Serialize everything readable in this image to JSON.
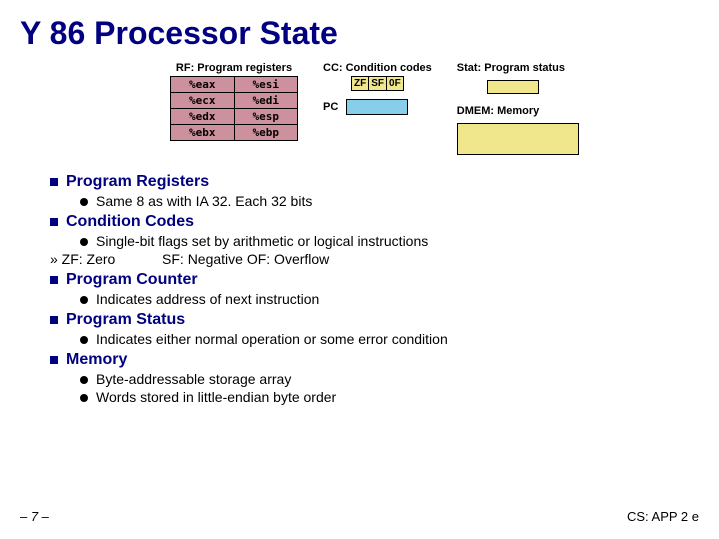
{
  "title": "Y 86 Processor State",
  "diagram": {
    "rf_label": "RF: Program registers",
    "regs": [
      [
        "%eax",
        "%esi"
      ],
      [
        "%ecx",
        "%edi"
      ],
      [
        "%edx",
        "%esp"
      ],
      [
        "%ebx",
        "%ebp"
      ]
    ],
    "cc_label": "CC: Condition codes",
    "cc_cells": [
      "ZF",
      "SF",
      "0F"
    ],
    "pc_label": "PC",
    "stat_label": "Stat: Program status",
    "dmem_label": "DMEM: Memory"
  },
  "sections": [
    {
      "title": "Program Registers",
      "bullets": [
        "Same 8 as with IA 32.  Each 32 bits"
      ]
    },
    {
      "title": "Condition Codes",
      "bullets": [
        "Single-bit flags set by arithmetic or logical instructions"
      ],
      "sub": "» ZF: Zero            SF: Negative OF: Overflow"
    },
    {
      "title": "Program Counter",
      "bullets": [
        "Indicates address of next instruction"
      ]
    },
    {
      "title": "Program Status",
      "bullets": [
        "Indicates either normal operation or some error condition"
      ]
    },
    {
      "title": "Memory",
      "bullets": [
        "Byte-addressable storage array",
        "Words stored in little-endian byte order"
      ]
    }
  ],
  "footer": {
    "page": "– 7 –",
    "source": "CS: APP 2 e"
  }
}
